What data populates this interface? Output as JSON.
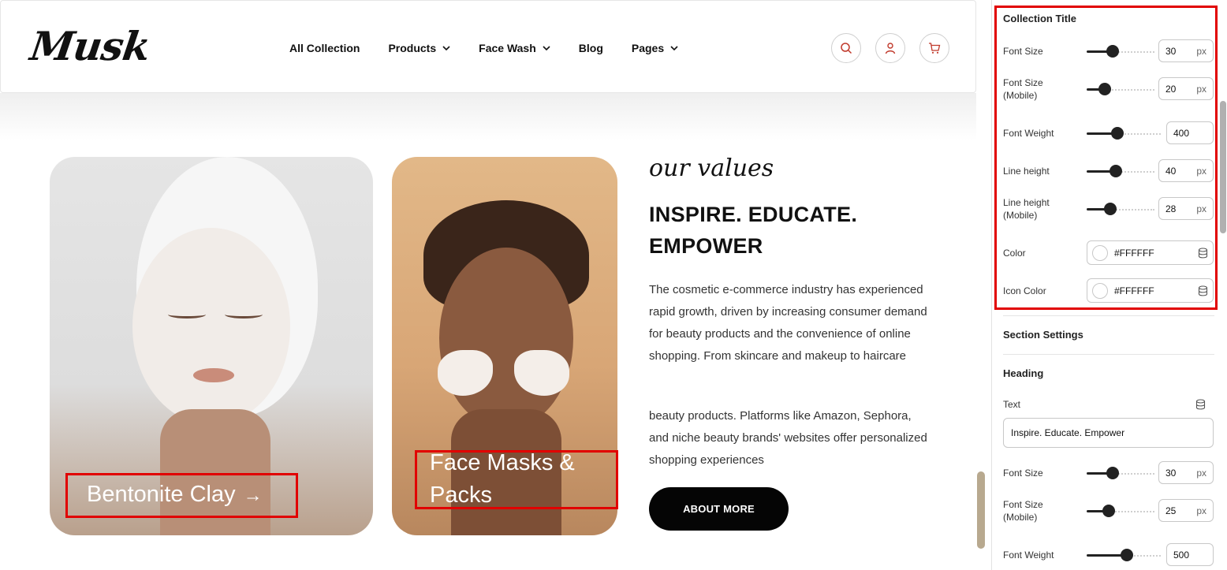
{
  "header": {
    "logo": "Musk",
    "nav": [
      {
        "label": "All Collection",
        "dropdown": false
      },
      {
        "label": "Products",
        "dropdown": true
      },
      {
        "label": "Face Wash",
        "dropdown": true
      },
      {
        "label": "Blog",
        "dropdown": false
      },
      {
        "label": "Pages",
        "dropdown": true
      }
    ],
    "icons": [
      "search-icon",
      "user-icon",
      "cart-icon"
    ],
    "icon_color": "#c0392b"
  },
  "collections": [
    {
      "title": "Bentonite Clay",
      "arrow": "→"
    },
    {
      "title": "Face Masks & Packs",
      "arrow": ""
    }
  ],
  "values": {
    "script_title": "our values",
    "heading": "INSPIRE. EDUCATE. EMPOWER",
    "paragraph_1": "The cosmetic e-commerce industry has experienced rapid growth, driven by increasing consumer demand for beauty products and the convenience of online shopping. From skincare and makeup to haircare",
    "paragraph_2": "beauty products. Platforms like Amazon, Sephora, and niche beauty brands' websites offer personalized shopping experiences",
    "button": "ABOUT MORE"
  },
  "panel": {
    "collection_title": {
      "heading": "Collection Title",
      "font_size": {
        "label": "Font Size",
        "value": "30",
        "unit": "px",
        "level": 0.35
      },
      "font_size_mobile": {
        "label": "Font Size (Mobile)",
        "value": "20",
        "unit": "px",
        "level": 0.22
      },
      "font_weight": {
        "label": "Font Weight",
        "value": "400",
        "level": 0.4
      },
      "line_height": {
        "label": "Line height",
        "value": "40",
        "unit": "px",
        "level": 0.42
      },
      "line_height_mobile": {
        "label": "Line height (Mobile)",
        "value": "28",
        "unit": "px",
        "level": 0.32
      },
      "color": {
        "label": "Color",
        "value": "#FFFFFF"
      },
      "icon_color": {
        "label": "Icon Color",
        "value": "#FFFFFF"
      }
    },
    "section_settings": {
      "heading": "Section Settings"
    },
    "heading": {
      "heading": "Heading",
      "text_label": "Text",
      "text_value": "Inspire. Educate. Empower",
      "font_size": {
        "label": "Font Size",
        "value": "30",
        "unit": "px",
        "level": 0.35
      },
      "font_size_mobile": {
        "label": "Font Size (Mobile)",
        "value": "25",
        "unit": "px",
        "level": 0.28
      },
      "font_weight": {
        "label": "Font Weight",
        "value": "500",
        "level": 0.55
      }
    }
  },
  "colors": {
    "accent_red": "#e10000",
    "button_bg": "#050505",
    "card_text": "#ffffff"
  }
}
